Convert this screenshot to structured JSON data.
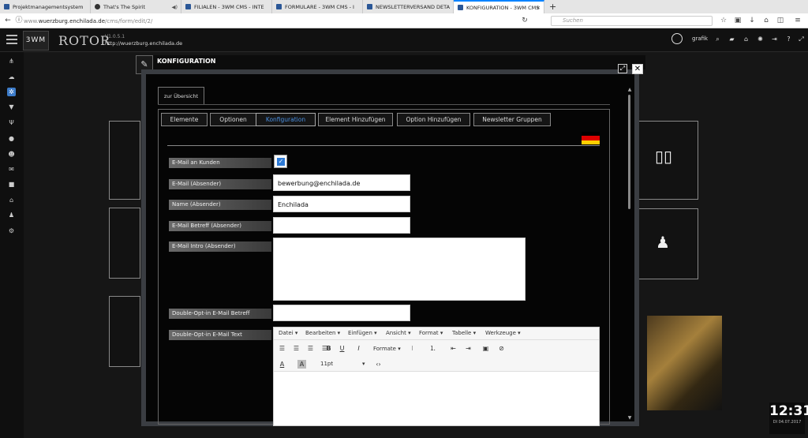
{
  "browser": {
    "tabs": [
      {
        "title": "Projektmanagementsystem",
        "active": false
      },
      {
        "title": "That's The Spirit",
        "active": false
      },
      {
        "title": "FILIALEN - 3WM CMS - INTE",
        "active": false
      },
      {
        "title": "FORMULARE - 3WM CMS - I",
        "active": false
      },
      {
        "title": "NEWSLETTERVERSAND DETA",
        "active": false
      },
      {
        "title": "KONFIGURATION - 3WM CMS",
        "active": true
      }
    ],
    "url_host": "wuerzburg.enchilada.de",
    "url_path": "/cms/form/edit/2/",
    "url_prefix": "www.",
    "search_placeholder": "Suchen"
  },
  "app": {
    "logo": "3WM",
    "name": "ROTOR",
    "version": "V1.0.5.1",
    "site": "http://wuerzburg.enchilada.de",
    "username": "grafik"
  },
  "modal": {
    "title": "KONFIGURATION",
    "overview_button": "zur Übersicht",
    "tabs": [
      "Elemente",
      "Optionen",
      "Konfiguration",
      "Element Hinzufügen",
      "Option Hinzufügen",
      "Newsletter Gruppen"
    ],
    "active_tab": "Konfiguration",
    "flag_colors": [
      "#000000",
      "#dd0000",
      "#ffce00"
    ],
    "form": {
      "email_customer_label": "E-Mail an Kunden",
      "email_customer_checked": true,
      "email_sender_label": "E-Mail (Absender)",
      "email_sender_value": "bewerbung@enchilada.de",
      "name_sender_label": "Name (Absender)",
      "name_sender_value": "Enchilada",
      "subject_sender_label": "E-Mail Betreff (Absender)",
      "subject_sender_value": "",
      "intro_sender_label": "E-Mail Intro (Absender)",
      "doi_subject_label": "Double-Opt-in E-Mail Betreff",
      "doi_text_label": "Double-Opt-in E-Mail Text"
    },
    "editor": {
      "menus": [
        "Datei ▾",
        "Bearbeiten ▾",
        "Einfügen ▾",
        "Ansicht ▾",
        "Format ▾",
        "Tabelle ▾",
        "Werkzeuge ▾"
      ],
      "formats_label": "Formate ▾",
      "font_size": "11pt",
      "bold": "B",
      "underline": "U",
      "italic": "I"
    }
  },
  "clock": {
    "time": "12:31",
    "date": "DI 04.07.2017"
  },
  "accent_color": "#3d7cc9"
}
